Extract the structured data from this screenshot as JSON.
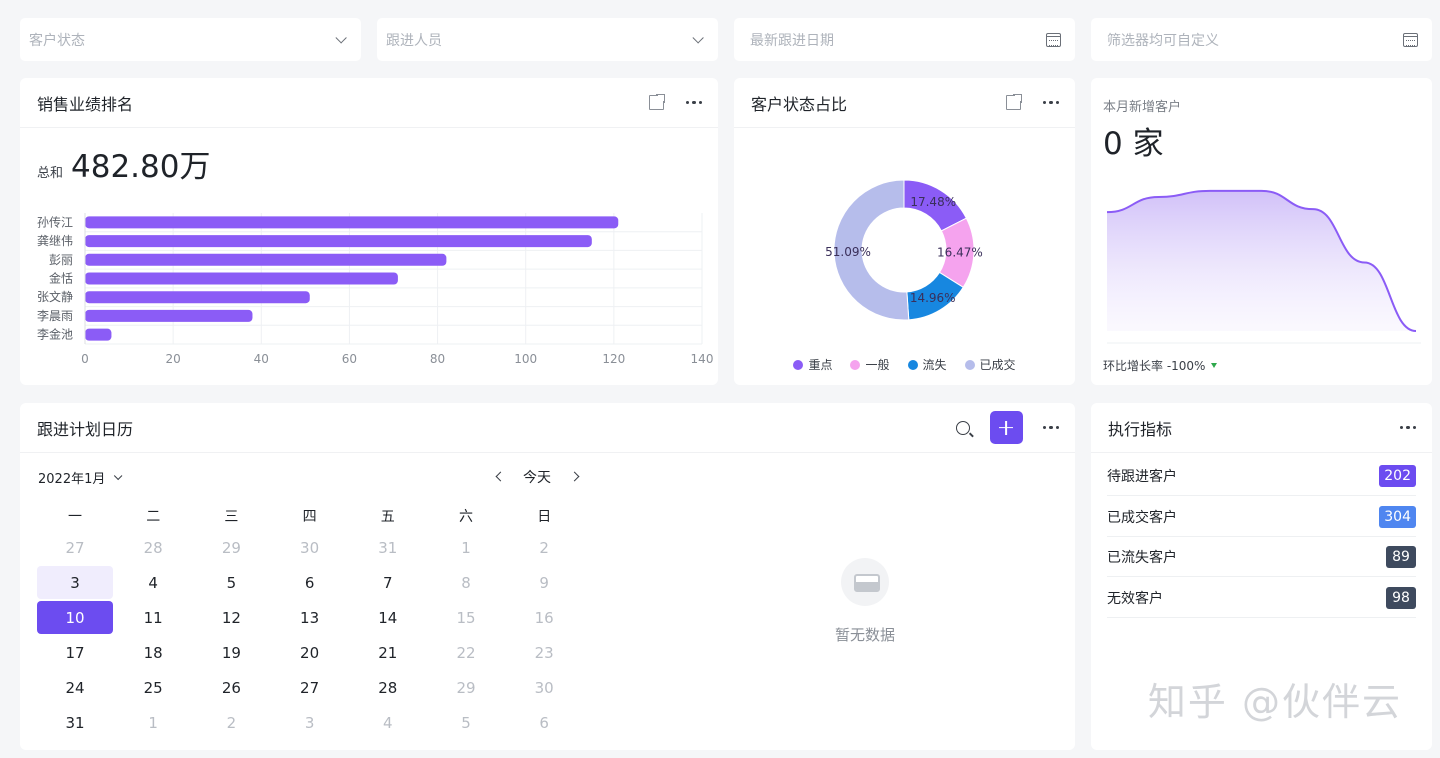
{
  "filters": [
    {
      "placeholder": "客户状态",
      "icon": "chevron-down-icon"
    },
    {
      "placeholder": "跟进人员",
      "icon": "chevron-down-icon"
    },
    {
      "placeholder": "最新跟进日期",
      "icon": "calendar-icon"
    },
    {
      "placeholder": "筛选器均可自定义",
      "icon": "calendar-icon"
    }
  ],
  "sales": {
    "title": "销售业绩排名",
    "total_label": "总和",
    "total_value": "482.80万"
  },
  "status": {
    "title": "客户状态占比",
    "legend": [
      "重点",
      "一般",
      "流失",
      "已成交"
    ]
  },
  "new_customers": {
    "label": "本月新增客户",
    "value": "0 家",
    "growth": "环比增长率 -100%",
    "series": [
      0.78,
      0.88,
      0.92,
      0.92,
      0.8,
      0.45,
      0.0
    ]
  },
  "chart_data": [
    {
      "type": "bar",
      "orientation": "horizontal",
      "categories": [
        "孙传江",
        "龚继伟",
        "彭丽",
        "金恬",
        "张文静",
        "李晨雨",
        "李金池"
      ],
      "values": [
        121,
        115,
        82,
        71,
        51,
        38,
        6
      ],
      "xlim": [
        0,
        140
      ],
      "xticks": [
        "0",
        "20",
        "40",
        "60",
        "80",
        "100",
        "120",
        "140"
      ],
      "color": "#8b5cf6",
      "grid": true
    },
    {
      "type": "pie",
      "style": "donut",
      "labels": [
        "重点",
        "一般",
        "流失",
        "已成交"
      ],
      "values": [
        17.48,
        16.47,
        14.96,
        51.09
      ],
      "value_labels": [
        "17.48%",
        "16.47%",
        "14.96%",
        "51.09%"
      ],
      "colors": [
        "#8b5cf6",
        "#f5a3ee",
        "#1787e0",
        "#b6bdeb"
      ],
      "legend": "bottom"
    }
  ],
  "calendar": {
    "title": "跟进计划日历",
    "month": "2022年1月",
    "today_label": "今天",
    "weekdays": [
      "一",
      "二",
      "三",
      "四",
      "五",
      "六",
      "日"
    ],
    "weeks": [
      [
        "27",
        "28",
        "29",
        "30",
        "31",
        "1",
        "2"
      ],
      [
        "3",
        "4",
        "5",
        "6",
        "7",
        "8",
        "9"
      ],
      [
        "10",
        "11",
        "12",
        "13",
        "14",
        "15",
        "16"
      ],
      [
        "17",
        "18",
        "19",
        "20",
        "21",
        "22",
        "23"
      ],
      [
        "24",
        "25",
        "26",
        "27",
        "28",
        "29",
        "30"
      ],
      [
        "31",
        "1",
        "2",
        "3",
        "4",
        "5",
        "6"
      ]
    ],
    "empty_text": "暂无数据",
    "accent": "#6c4cf0"
  },
  "kpi": {
    "title": "执行指标",
    "items": [
      {
        "label": "待跟进客户",
        "value": "202",
        "color": "#6c4cf0"
      },
      {
        "label": "已成交客户",
        "value": "304",
        "color": "#4f86f0"
      },
      {
        "label": "已流失客户",
        "value": "89",
        "color": "#3e4a5e"
      },
      {
        "label": "无效客户",
        "value": "98",
        "color": "#3e4a5e"
      }
    ]
  },
  "watermark": "知乎 @伙伴云"
}
